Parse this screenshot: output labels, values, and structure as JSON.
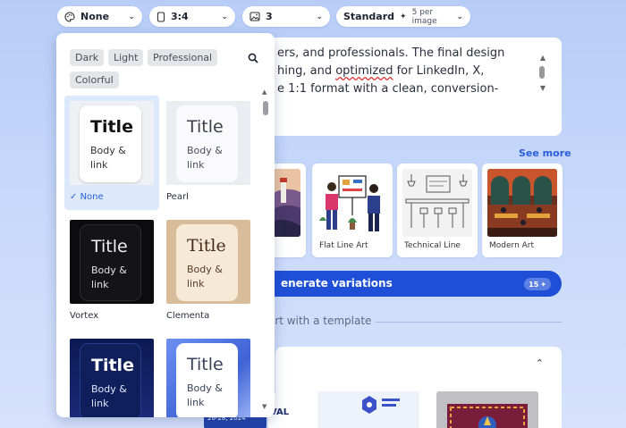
{
  "toolbar": {
    "theme": {
      "label": "None",
      "icon": "palette-icon"
    },
    "ratio": {
      "label": "3:4",
      "icon": "phone-frame-icon"
    },
    "count": {
      "label": "3",
      "icon": "image-icon"
    },
    "quality": {
      "label": "Standard",
      "sub": "5 per image",
      "icon": "sparkle-icon"
    }
  },
  "prompt": {
    "lines": [
      "ers, and professionals. The final design",
      "hing, and optimized for LinkedIn, X,",
      "e 1:1 format with a clean, conversion-"
    ],
    "misspelled_word": "optimized"
  },
  "styles": {
    "see_more": "See more",
    "items": [
      {
        "label": "Flat Line Art"
      },
      {
        "label": "Technical Line"
      },
      {
        "label": "Modern Art"
      }
    ]
  },
  "generate": {
    "label": "enerate variations",
    "credits": "15"
  },
  "template_divider": "art with a template",
  "theme_panel": {
    "filters": [
      "Dark",
      "Light",
      "Professional",
      "Colorful"
    ],
    "themes": [
      {
        "name": "None",
        "title": "Title",
        "body": "Body & link",
        "selected": true
      },
      {
        "name": "Pearl",
        "title": "Title",
        "body": "Body & link"
      },
      {
        "name": "Vortex",
        "title": "Title",
        "body": "Body & link"
      },
      {
        "name": "Clementa",
        "title": "Title",
        "body": "Body & link"
      },
      {
        "name": "",
        "title": "Title",
        "body": "Body & link"
      },
      {
        "name": "",
        "title": "Title",
        "body": "Body & link"
      }
    ]
  },
  "colors": {
    "accent": "#2b5fd9",
    "generate_bg": "#1f4fd6",
    "selected_tile_bg": "#dce8fb"
  }
}
